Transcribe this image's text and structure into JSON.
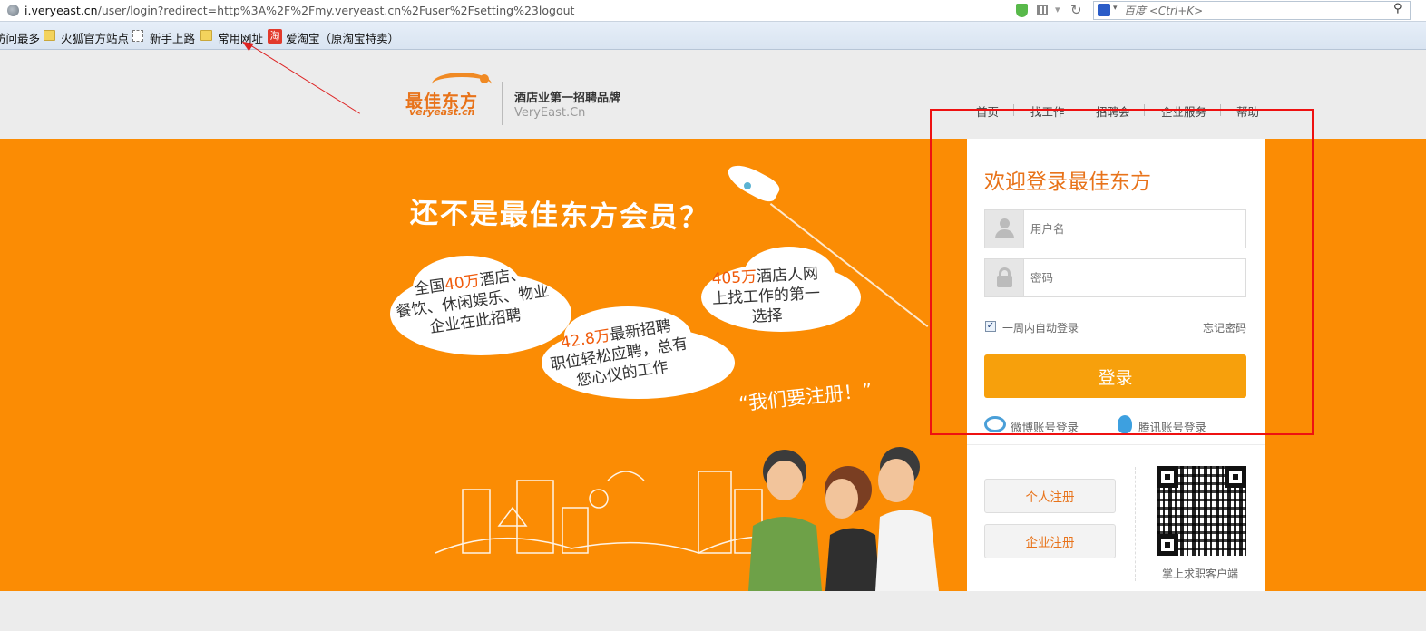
{
  "browser": {
    "url_host": "i.veryeast.cn",
    "url_path": "/user/login?redirect=http%3A%2F%2Fmy.veryeast.cn%2Fuser%2Fsetting%23logout",
    "search_placeholder": "百度 <Ctrl+K>"
  },
  "bookmarks": [
    {
      "label": "访问最多",
      "icon": "none"
    },
    {
      "label": "火狐官方站点",
      "icon": "folder-icon"
    },
    {
      "label": "新手上路",
      "icon": "page-icon"
    },
    {
      "label": "常用网址",
      "icon": "folder-icon"
    },
    {
      "label": "爱淘宝（原淘宝特卖）",
      "icon": "taobao-icon"
    }
  ],
  "header": {
    "logo_cn": "最佳东方",
    "logo_en": "veryeast.cn",
    "slogan": "酒店业第一招聘品牌",
    "domain": "VeryEast.Cn",
    "nav": [
      "首页",
      "找工作",
      "招聘会",
      "企业服务",
      "帮助"
    ]
  },
  "banner": {
    "headline": "还不是最佳东方会员？",
    "cloud1": {
      "highlight": "40万",
      "pre": "全国",
      "post": "酒店、",
      "line2": "餐饮、休闲娱乐、物业",
      "line3": "企业在此招聘"
    },
    "cloud2": {
      "highlight": "42.8万",
      "post": "最新招聘",
      "line2": "职位轻松应聘，总有",
      "line3": "您心仪的工作"
    },
    "cloud3": {
      "highlight": "405万",
      "post": "酒店人网",
      "line2": "上找工作的第一",
      "line3": "选择"
    },
    "shout": "“我们要注册！”"
  },
  "login": {
    "title": "欢迎登录最佳东方",
    "username_placeholder": "用户名",
    "password_placeholder": "密码",
    "remember_label": "一周内自动登录",
    "remember_checked": true,
    "forgot_label": "忘记密码",
    "submit_label": "登录",
    "weibo_label": "微博账号登录",
    "qq_label": "腾讯账号登录",
    "personal_register_label": "个人注册",
    "company_register_label": "企业注册",
    "qr_caption": "掌上求职客户端"
  },
  "colors": {
    "accent": "#e8731a",
    "banner": "#fb8c04",
    "login_button": "#f7a00c",
    "annotation": "#e11111"
  }
}
